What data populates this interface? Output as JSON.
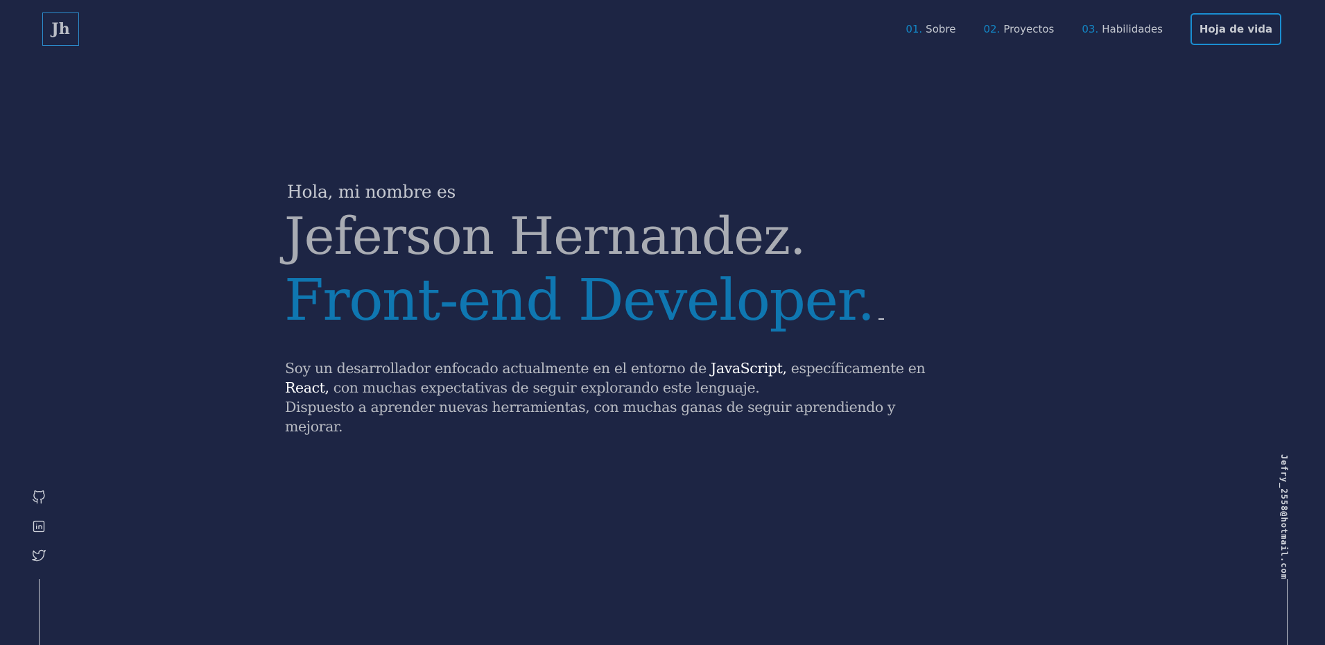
{
  "logo": {
    "text": "Jh"
  },
  "nav": {
    "items": [
      {
        "num": "01.",
        "label": "Sobre"
      },
      {
        "num": "02.",
        "label": "Proyectos"
      },
      {
        "num": "03.",
        "label": "Habilidades"
      }
    ],
    "cv_button": "Hoja de vida"
  },
  "hero": {
    "greeting": "Hola, mi nombre es",
    "name": "Jeferson Hernandez.",
    "role": "Front-end Developer."
  },
  "bio": {
    "p1_before": "Soy un desarrollador enfocado actualmente en el entorno de ",
    "p1_js": "JavaScript,",
    "p1_after": " específicamente en",
    "p2_react": "React,",
    "p2_after": " con muchas expectativas de seguir explorando este lenguaje.",
    "p3": "Dispuesto a aprender nuevas herramientas, con muchas ganas de seguir aprendiendo y mejorar."
  },
  "social": {
    "icons": [
      "github-icon",
      "linkedin-icon",
      "twitter-icon"
    ]
  },
  "email": "Jefry_2558@hotmail.com",
  "colors": {
    "background": "#1d2544",
    "accent": "#0f77b1",
    "text": "#b7bac2"
  }
}
